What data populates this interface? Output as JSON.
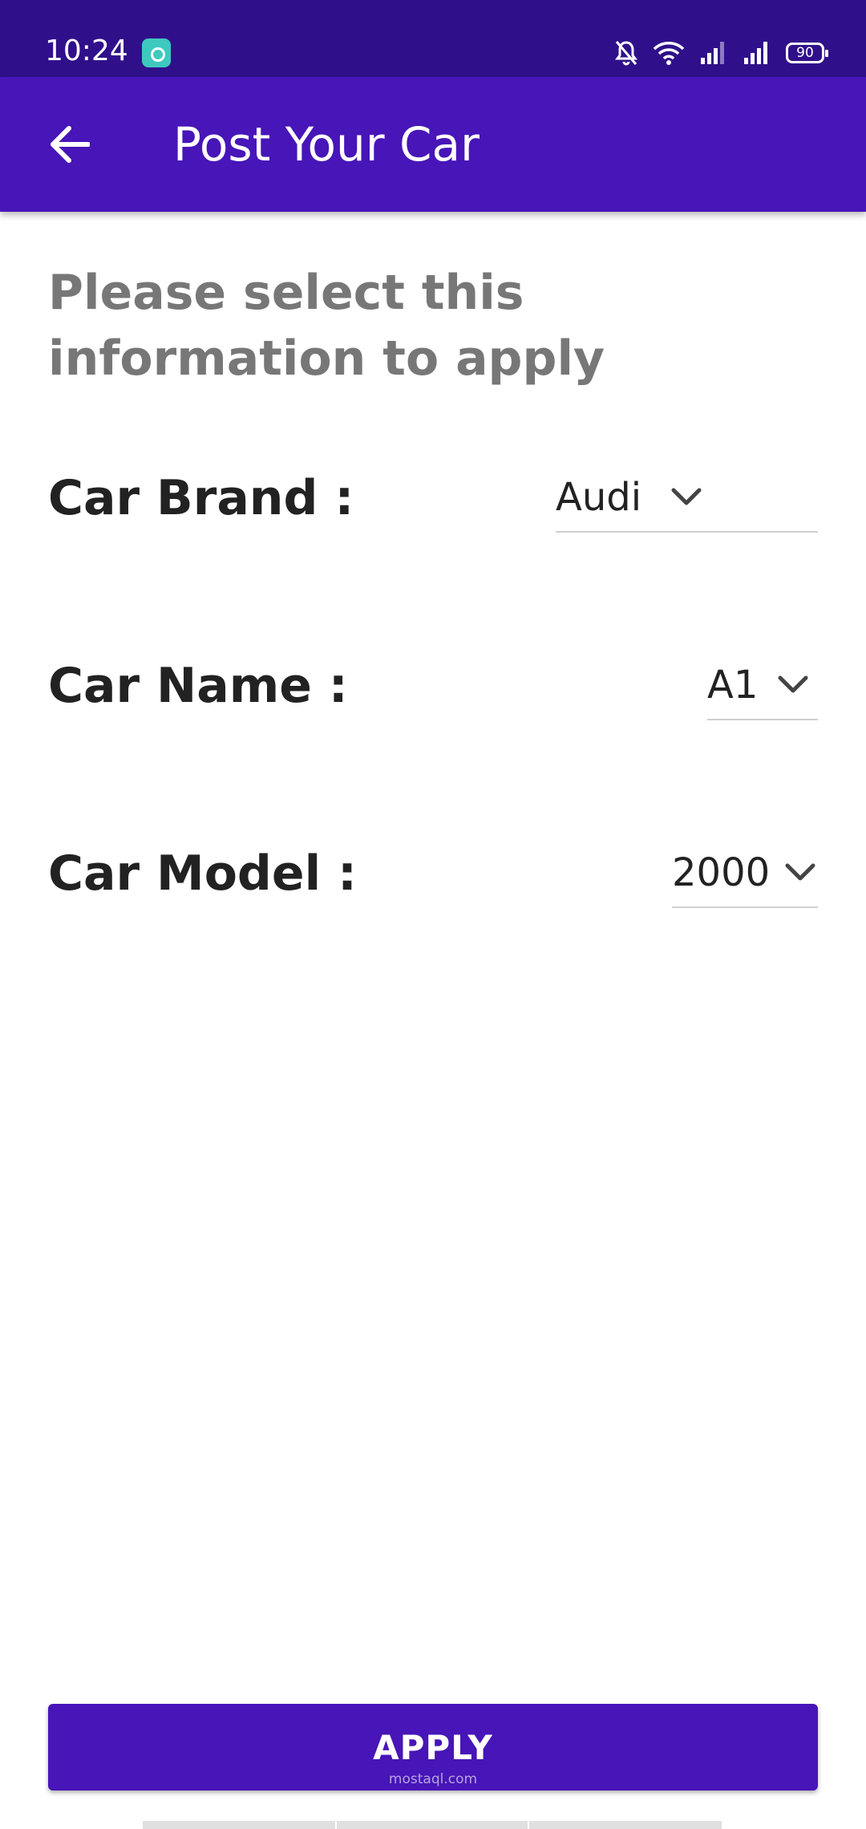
{
  "status_bar": {
    "time": "10:24",
    "battery": "90",
    "icons": [
      "app-notification-icon",
      "mute-bell-icon",
      "wifi-icon",
      "signal-icon",
      "signal-icon",
      "battery-icon"
    ]
  },
  "app_bar": {
    "title": "Post Your Car",
    "back_icon": "arrow-left-icon"
  },
  "form": {
    "instruction": "Please select this information to apply",
    "fields": [
      {
        "label": "Car Brand :",
        "value": "Audi"
      },
      {
        "label": "Car Name :",
        "value": "A1"
      },
      {
        "label": "Car Model :",
        "value": "2000"
      }
    ]
  },
  "actions": {
    "apply_label": "APPLY",
    "watermark": "mostaql.com"
  },
  "colors": {
    "status_bar": "#30108a",
    "app_bar": "#4715b8",
    "button": "#4715b8",
    "instruction_text": "#777777",
    "label_text": "#222222"
  }
}
